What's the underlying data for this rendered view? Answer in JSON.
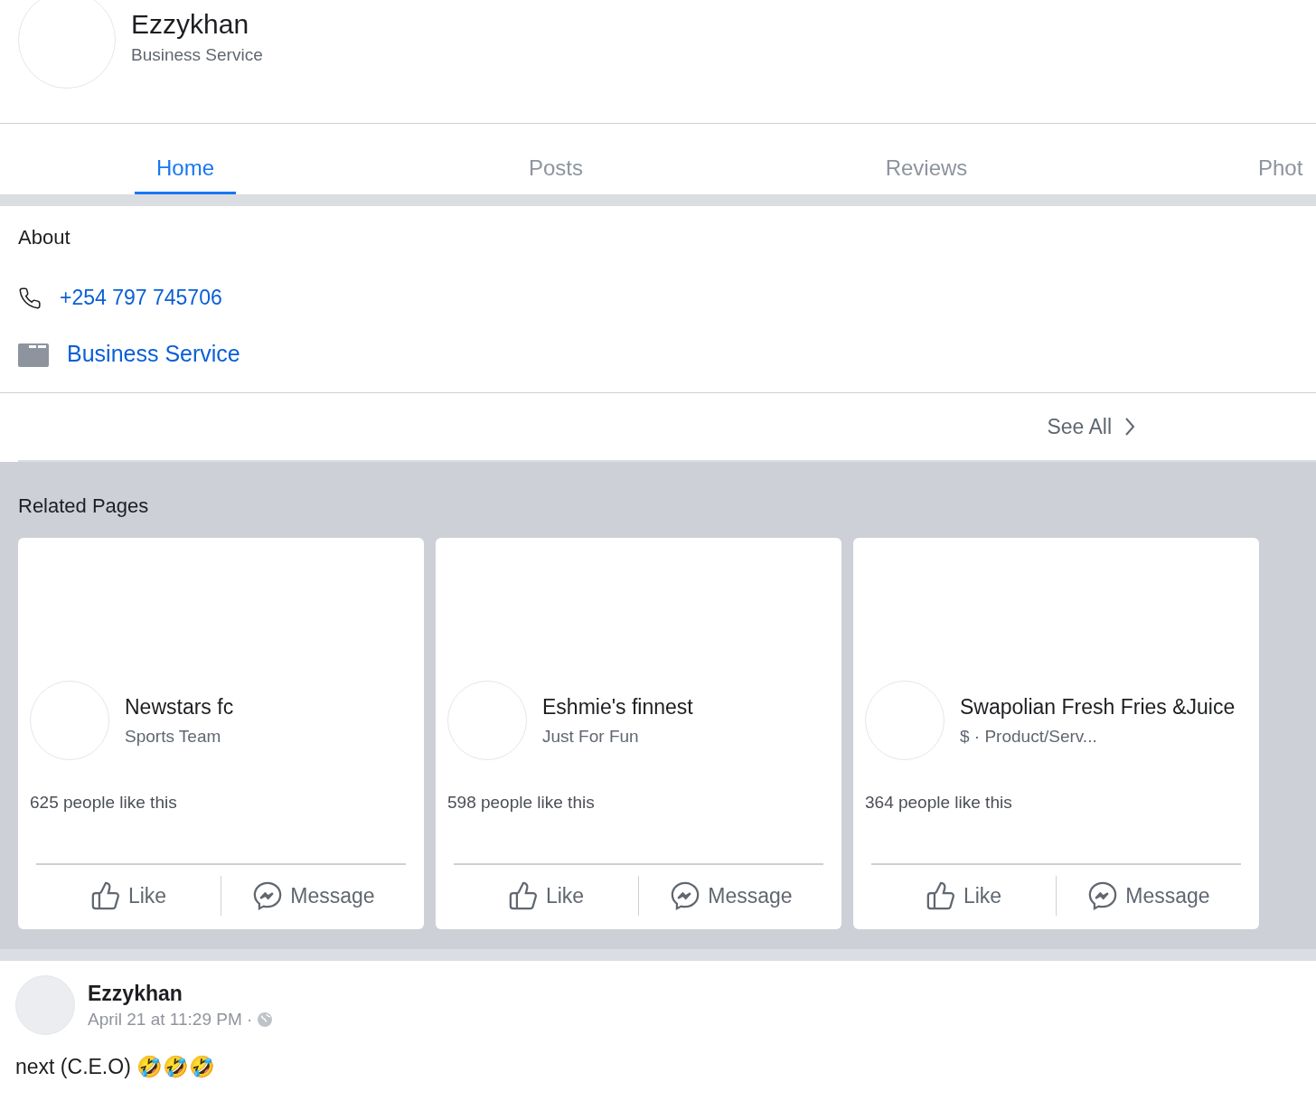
{
  "page": {
    "name": "Ezzykhan",
    "category": "Business Service"
  },
  "tabs": [
    {
      "label": "Home",
      "selected": true
    },
    {
      "label": "Posts",
      "selected": false
    },
    {
      "label": "Reviews",
      "selected": false
    },
    {
      "label": "Phot",
      "selected": false
    }
  ],
  "about": {
    "title": "About",
    "phone": "+254 797 745706",
    "category": "Business Service",
    "see_all": "See All"
  },
  "related_pages": {
    "title": "Related Pages",
    "cards": [
      {
        "name": "Newstars fc",
        "category": "Sports Team",
        "likes": "625 people like this",
        "like": "Like",
        "message": "Message"
      },
      {
        "name": "Eshmie's finnest",
        "category": "Just For Fun",
        "likes": "598 people like this",
        "like": "Like",
        "message": "Message"
      },
      {
        "name": "Swapolian Fresh Fries &Juice",
        "category": "$ · Product/Serv...",
        "likes": "364 people like this",
        "like": "Like",
        "message": "Message"
      }
    ]
  },
  "post": {
    "author": "Ezzykhan",
    "time": "April 21 at 11:29 PM ·",
    "text": "next (C.E.O) 🤣🤣🤣"
  }
}
